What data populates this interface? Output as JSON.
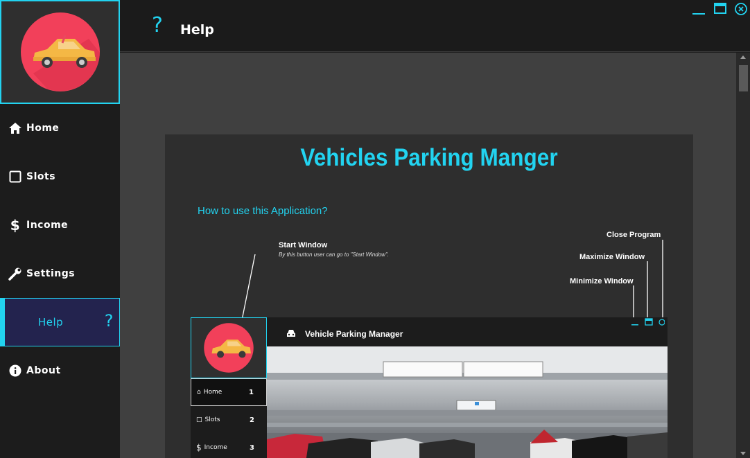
{
  "header": {
    "title": "Help",
    "icon": "question-icon"
  },
  "window_controls": {
    "minimize_icon": "minimize-icon",
    "maximize_icon": "maximize-icon",
    "close_icon": "close-icon"
  },
  "sidebar": {
    "items": [
      {
        "label": "Home",
        "icon": "home-icon"
      },
      {
        "label": "Slots",
        "icon": "square-icon"
      },
      {
        "label": "Income",
        "icon": "dollar-icon"
      },
      {
        "label": "Settings",
        "icon": "wrench-icon"
      },
      {
        "label": "Help",
        "icon": "question-icon",
        "active": true
      },
      {
        "label": "About",
        "icon": "info-icon"
      }
    ]
  },
  "help": {
    "title": "Vehicles Parking Manger",
    "subtitle": "How to use this Application?",
    "annotations": {
      "start_window": "Start Window",
      "start_window_desc": "By this button user can go to \"Start Window\".",
      "close_program": "Close Program",
      "maximize_window": "Maximize Window",
      "minimize_window": "Minimize Window"
    },
    "mini_app": {
      "title": "Vehicle Parking Manager",
      "nav": [
        {
          "label": "Home",
          "num": "1"
        },
        {
          "label": "Slots",
          "num": "2"
        },
        {
          "label": "Income",
          "num": "3"
        }
      ]
    }
  },
  "colors": {
    "accent": "#22d3f0",
    "sidebar_bg": "#1c1c1c",
    "content_bg": "#404040",
    "active_bg": "#23234e",
    "logo_circle": "#f2405a"
  }
}
